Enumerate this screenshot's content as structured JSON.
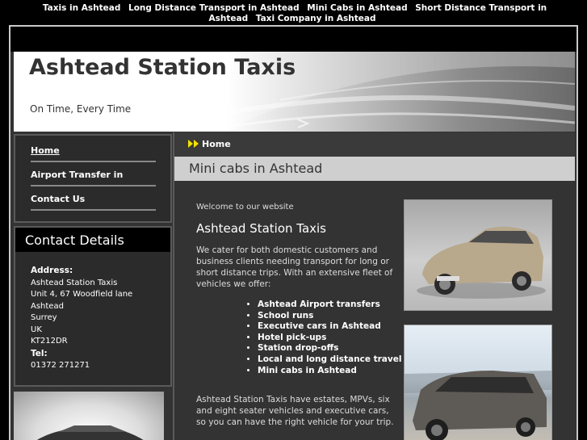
{
  "top_nav": {
    "links": [
      "Taxis in Ashtead",
      "Long Distance Transport in Ashtead",
      "Mini Cabs in Ashtead",
      "Short Distance Transport in Ashtead",
      "Taxi Company in Ashtead"
    ]
  },
  "banner": {
    "title": "Ashtead Station Taxis",
    "tagline": "On Time, Every Time"
  },
  "menu": {
    "items": [
      "Home",
      "Airport Transfer in",
      "Contact Us"
    ]
  },
  "contact": {
    "heading": "Contact Details",
    "address_label": "Address:",
    "address_lines": [
      "Ashtead Station Taxis",
      "Unit 4, 67 Woodfield lane",
      "Ashtead",
      "Surrey",
      "UK",
      "KT212DR"
    ],
    "tel_label": "Tel:",
    "tel": "01372 271271"
  },
  "breadcrumb": {
    "label": "Home"
  },
  "page": {
    "title": "Mini cabs in Ashtead",
    "welcome": "Welcome to our website",
    "heading": "Ashtead Station Taxis",
    "intro": "We cater for both domestic customers and business clients needing transport for long or short distance trips. With an extensive fleet of vehicles we offer:",
    "services": [
      "Ashtead Airport transfers",
      "School runs",
      "Executive cars in Ashtead",
      "Hotel pick-ups",
      "Station drop-offs",
      "Local and long distance travel",
      "Mini cabs in Ashtead"
    ],
    "outro": "Ashtead Station Taxis have estates, MPVs, six and eight seater vehicles and executive cars, so you can have the right vehicle for your trip."
  },
  "colors": {
    "background": "#000000",
    "panel": "#333333",
    "title_bar": "#cfcfcf",
    "accent_arrow": "#f5e200"
  }
}
